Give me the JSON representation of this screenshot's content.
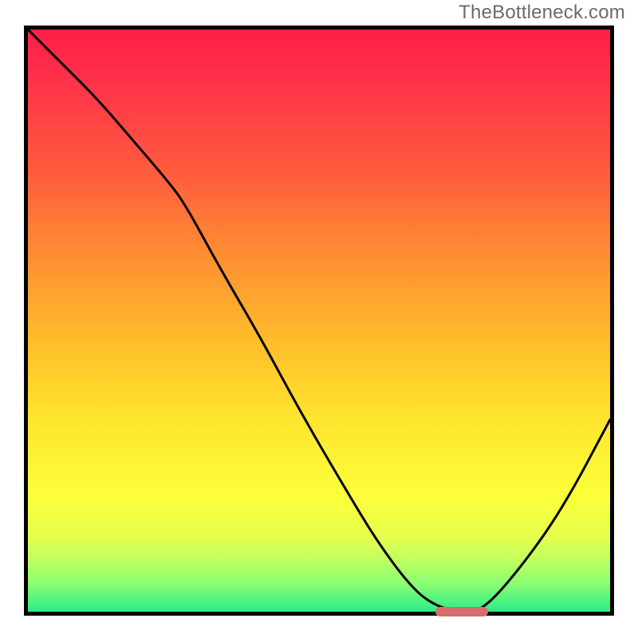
{
  "watermark_text": "TheBottleneck.com",
  "colors": {
    "frame": "#000000",
    "curve": "#000000",
    "marker": "#d76d6d",
    "gradient_top": "#ff1f47",
    "gradient_bottom": "#2aec86"
  },
  "chart_data": {
    "type": "line",
    "title": "",
    "xlabel": "",
    "ylabel": "",
    "xlim": [
      0,
      100
    ],
    "ylim": [
      0,
      100
    ],
    "grid": false,
    "series": [
      {
        "name": "bottleneck-curve",
        "x": [
          0,
          6,
          12,
          18,
          24,
          27,
          33,
          40,
          47,
          54,
          60,
          66,
          70,
          74,
          78,
          85,
          92,
          100
        ],
        "values": [
          100,
          94,
          88,
          81,
          74,
          70,
          59,
          47,
          34,
          22,
          12,
          4,
          1,
          0,
          0,
          8,
          18,
          33
        ]
      }
    ],
    "annotations": [
      {
        "name": "optimum-marker",
        "x_start": 70,
        "x_end": 79,
        "y": 0
      }
    ]
  }
}
